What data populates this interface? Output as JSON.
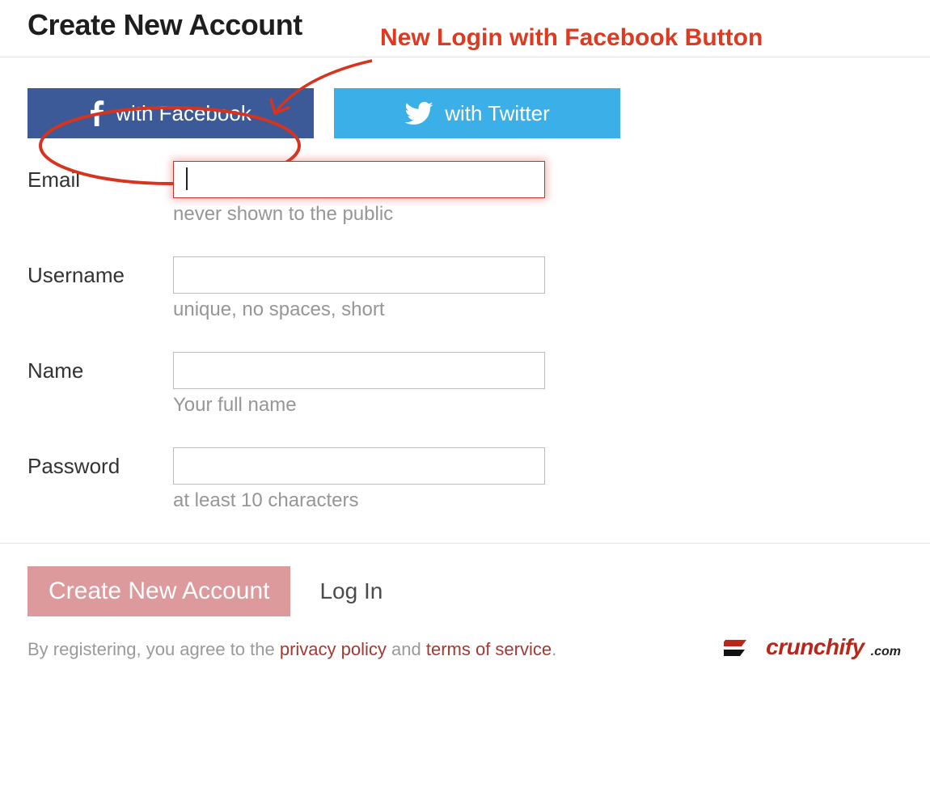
{
  "title": "Create New Account",
  "annotation": {
    "text": "New Login with Facebook Button"
  },
  "social": {
    "facebook_label": "with Facebook",
    "twitter_label": "with Twitter"
  },
  "form": {
    "email": {
      "label": "Email",
      "hint": "never shown to the public",
      "value": ""
    },
    "username": {
      "label": "Username",
      "hint": "unique, no spaces, short",
      "value": ""
    },
    "name": {
      "label": "Name",
      "hint": "Your full name",
      "value": ""
    },
    "password": {
      "label": "Password",
      "hint": "at least 10 characters",
      "value": ""
    }
  },
  "actions": {
    "create_label": "Create New Account",
    "login_label": "Log In"
  },
  "legal": {
    "prefix": "By registering, you agree to the ",
    "privacy": "privacy policy",
    "middle": " and ",
    "terms": "terms of service",
    "suffix": "."
  },
  "brand": {
    "name": "crunchify",
    "suffix": ".com"
  }
}
